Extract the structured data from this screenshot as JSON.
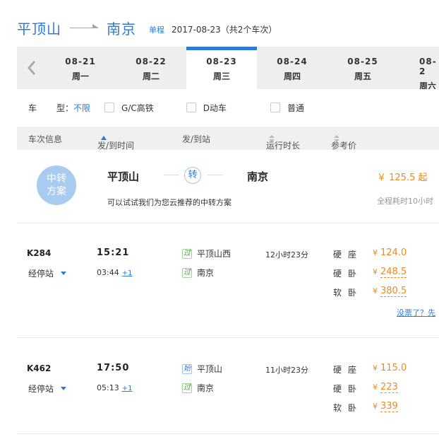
{
  "header": {
    "from_city": "平顶山",
    "to_city": "南京",
    "trip_type": "单程",
    "date_info": "2017-08-23（共2个车次）"
  },
  "date_tabs": [
    {
      "date": "08-21",
      "weekday": "周一",
      "active": false
    },
    {
      "date": "08-22",
      "weekday": "周二",
      "active": false
    },
    {
      "date": "08-23",
      "weekday": "周三",
      "active": true
    },
    {
      "date": "08-24",
      "weekday": "周四",
      "active": false
    },
    {
      "date": "08-25",
      "weekday": "周五",
      "active": false
    },
    {
      "date": "08-2",
      "weekday": "周六",
      "active": false
    }
  ],
  "filter": {
    "type_label_1": "车",
    "type_label_2": "型：",
    "unlimited": "不限",
    "options": [
      "G/C高铁",
      "D动车",
      "普通"
    ]
  },
  "columns": {
    "train_info": "车次信息",
    "dep_arr_time": "发/到时间",
    "dep_arr_station": "发/到站",
    "duration": "运行时长",
    "ref_price": "参考价"
  },
  "transfer": {
    "badge_line1": "中转",
    "badge_line2": "方案",
    "from": "平顶山",
    "via": "转",
    "to": "南京",
    "price": "￥ 125.5 起",
    "tip": "可以试试我们为您云推荐的中转方案",
    "total_time": "全程耗时10小时"
  },
  "trains": [
    {
      "number": "K284",
      "stops_label": "经停站",
      "dep_time": "15:21",
      "arr_time": "03:44",
      "day_offset": "+1",
      "dep_station_tag": "过",
      "dep_station": "平顶山西",
      "arr_station_tag": "过",
      "arr_station": "南京",
      "duration": "12小时23分",
      "seats": [
        {
          "type": "硬座",
          "price": "124.0",
          "dashed": false
        },
        {
          "type": "硬卧",
          "price": "248.5",
          "dashed": true
        },
        {
          "type": "软卧",
          "price": "380.5",
          "dashed": true
        }
      ],
      "no_ticket_link": "没票了？先"
    },
    {
      "number": "K462",
      "stops_label": "经停站",
      "dep_time": "17:50",
      "arr_time": "05:13",
      "day_offset": "+1",
      "dep_station_tag": "始",
      "dep_station": "平顶山",
      "arr_station_tag": "过",
      "arr_station": "南京",
      "duration": "11小时23分",
      "seats": [
        {
          "type": "硬座",
          "price": "115.0",
          "dashed": false
        },
        {
          "type": "硬卧",
          "price": "223",
          "dashed": true
        },
        {
          "type": "软卧",
          "price": "339",
          "dashed": true
        }
      ]
    }
  ],
  "colors": {
    "accent": "#2a7bd4",
    "price": "#f08a1a",
    "badge": "#a8ccf0"
  },
  "icons": {
    "prev": "chevron-left-icon",
    "sort_active": "sort-up-icon",
    "sort": "sort-icon",
    "expand": "caret-down-icon"
  }
}
